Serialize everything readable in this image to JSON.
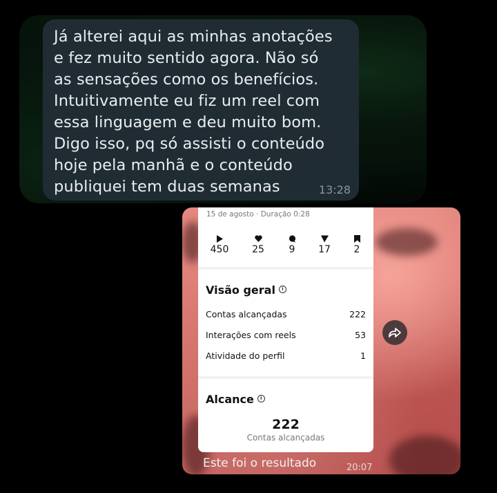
{
  "message1": {
    "text": "Já alterei aqui as minhas anotações\ne fez muito sentido agora. Não só\nas sensações como os benefícios.\nIntuitivamente eu fiz um reel com\nessa linguagem e deu muito bom.\nDigo isso, pq só assisti o conteúdo\nhoje pela manhã e o conteúdo\npubliquei tem duas semanas",
    "time": "13:28"
  },
  "message2": {
    "caption": "Este foi o resultado",
    "time": "20:07",
    "forward_icon": "forward-icon",
    "screenshot": {
      "meta": "15 de agosto · Duração 0:28",
      "stats": [
        {
          "icon": "play-icon",
          "value": "450"
        },
        {
          "icon": "heart-icon",
          "value": "25"
        },
        {
          "icon": "comment-icon",
          "value": "9"
        },
        {
          "icon": "send-icon",
          "value": "17"
        },
        {
          "icon": "bookmark-icon",
          "value": "2"
        }
      ],
      "overview": {
        "title": "Visão geral",
        "rows": [
          {
            "label": "Contas alcançadas",
            "value": "222"
          },
          {
            "label": "Interações com reels",
            "value": "53"
          },
          {
            "label": "Atividade do perfil",
            "value": "1"
          }
        ]
      },
      "reach": {
        "title": "Alcance",
        "value": "222",
        "label": "Contas alcançadas"
      }
    }
  },
  "colors": {
    "bubble": "#1f2c34",
    "text": "#e9edef",
    "timestamp": "#8a959c",
    "photo_accent": "#e48a82"
  }
}
